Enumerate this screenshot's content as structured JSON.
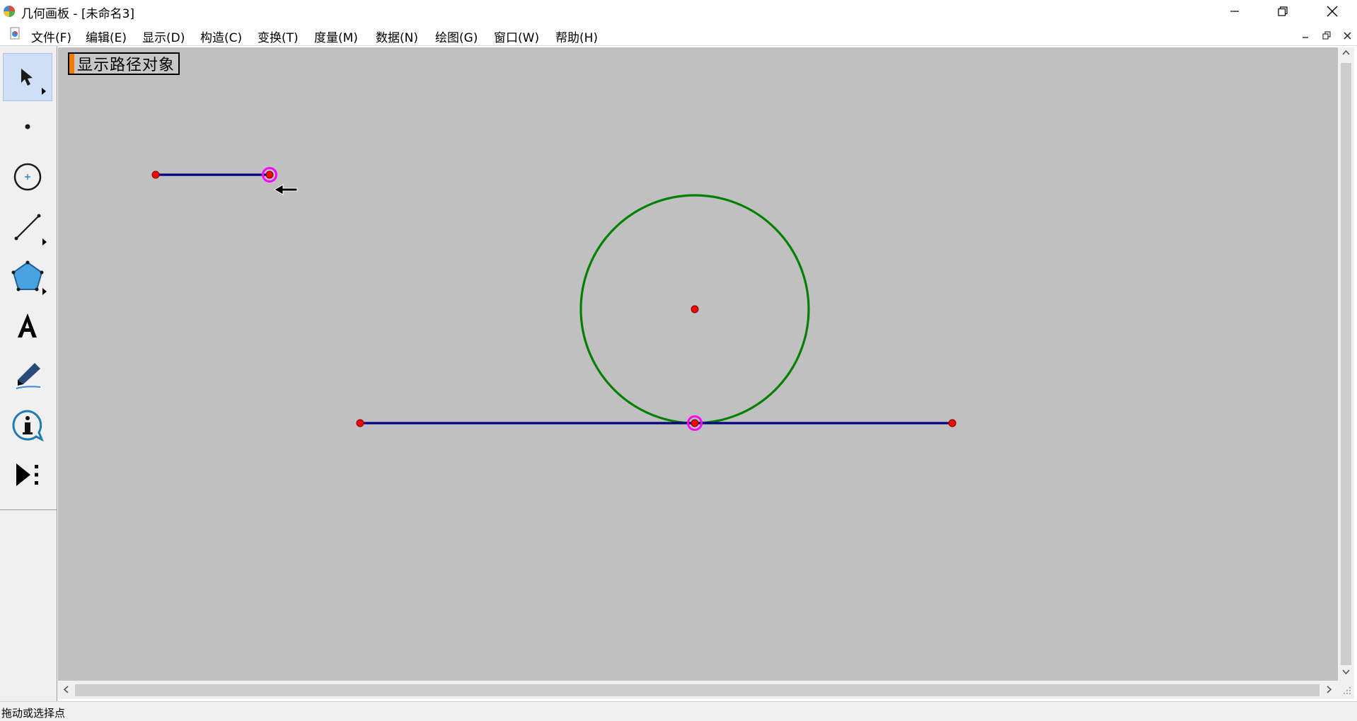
{
  "window": {
    "title": "几何画板 - [未命名3]"
  },
  "menu": {
    "items": [
      {
        "label": "文件(F)",
        "name": "menu-file"
      },
      {
        "label": "编辑(E)",
        "name": "menu-edit"
      },
      {
        "label": "显示(D)",
        "name": "menu-display"
      },
      {
        "label": "构造(C)",
        "name": "menu-construct"
      },
      {
        "label": "变换(T)",
        "name": "menu-transform"
      },
      {
        "label": "度量(M)",
        "name": "menu-measure"
      },
      {
        "label": "数据(N)",
        "name": "menu-data"
      },
      {
        "label": "绘图(G)",
        "name": "menu-graph"
      },
      {
        "label": "窗口(W)",
        "name": "menu-window"
      },
      {
        "label": "帮助(H)",
        "name": "menu-help"
      }
    ]
  },
  "toolbox": {
    "tools": [
      {
        "name": "selection-arrow-tool",
        "icon": "arrow-pointer-icon",
        "selected": true
      },
      {
        "name": "point-tool",
        "icon": "point-icon",
        "selected": false
      },
      {
        "name": "compass-tool",
        "icon": "circle-icon",
        "selected": false
      },
      {
        "name": "straightedge-tool",
        "icon": "segment-icon",
        "selected": false
      },
      {
        "name": "polygon-tool",
        "icon": "pentagon-icon",
        "selected": false
      },
      {
        "name": "text-tool",
        "icon": "letter-a-icon",
        "selected": false
      },
      {
        "name": "marker-tool",
        "icon": "pen-icon",
        "selected": false
      },
      {
        "name": "information-tool",
        "icon": "info-icon",
        "selected": false
      },
      {
        "name": "custom-tool",
        "icon": "play-dots-icon",
        "selected": false
      }
    ]
  },
  "sketch": {
    "action_button_label": "显示路径对象",
    "colors": {
      "canvas": "#c0c0c0",
      "segment": "#00007f",
      "circle": "#008000",
      "point": "#ff0000",
      "point_highlight": "#ff00ff",
      "action_handle": "#f07c00"
    }
  },
  "status": {
    "text": "拖动或选择点"
  }
}
